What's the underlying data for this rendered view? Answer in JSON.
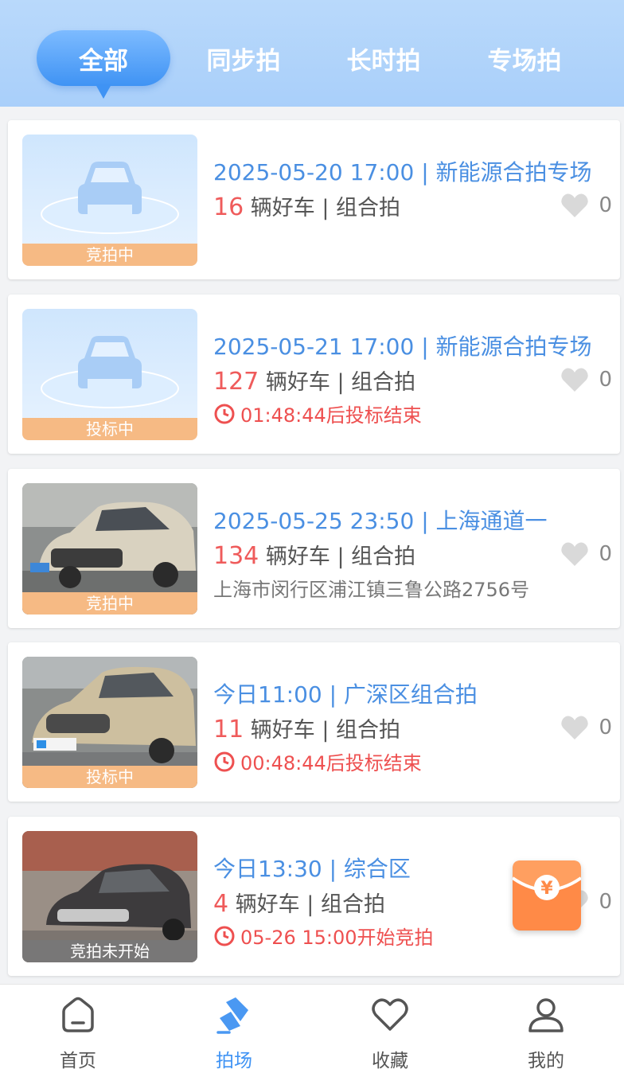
{
  "tabs": [
    {
      "label": "全部",
      "active": true
    },
    {
      "label": "同步拍",
      "active": false
    },
    {
      "label": "长时拍",
      "active": false
    },
    {
      "label": "专场拍",
      "active": false
    }
  ],
  "auctions": [
    {
      "title": "2025-05-20 17:00 | 新能源合拍专场",
      "count": "16",
      "desc": "辆好车 | 组合拍",
      "status": "竞拍中",
      "extra": "",
      "extra_type": "none",
      "favorites": "0",
      "image": "placeholder-car"
    },
    {
      "title": "2025-05-21 17:00 | 新能源合拍专场",
      "count": "127",
      "desc": "辆好车 | 组合拍",
      "status": "投标中",
      "extra": "01:48:44后投标结束",
      "extra_type": "countdown",
      "favorites": "0",
      "image": "placeholder-car"
    },
    {
      "title": "2025-05-25 23:50 | 上海通道一",
      "count": "134",
      "desc": "辆好车 | 组合拍",
      "status": "竞拍中",
      "extra": "上海市闵行区浦江镇三鲁公路2756号",
      "extra_type": "address",
      "favorites": "0",
      "image": "photo-suv-champagne"
    },
    {
      "title": "今日11:00 | 广深区组合拍",
      "count": "11",
      "desc": "辆好车 | 组合拍",
      "status": "投标中",
      "extra": "00:48:44后投标结束",
      "extra_type": "countdown",
      "favorites": "0",
      "image": "photo-suv-gold"
    },
    {
      "title": "今日13:30 | 综合区",
      "count": "4",
      "desc": "辆好车 | 组合拍",
      "status": "竞拍未开始",
      "extra": "05-26 15:00开始竞拍",
      "extra_type": "countdown",
      "favorites": "0",
      "image": "photo-sedan-dark"
    }
  ],
  "red_packet": {
    "symbol": "¥"
  },
  "bottom_nav": [
    {
      "label": "首页",
      "icon": "home-icon",
      "active": false
    },
    {
      "label": "拍场",
      "icon": "gavel-icon",
      "active": true
    },
    {
      "label": "收藏",
      "icon": "heart-icon",
      "active": false
    },
    {
      "label": "我的",
      "icon": "user-icon",
      "active": false
    }
  ],
  "colors": {
    "accent": "#3f93f4",
    "title_blue": "#4a8fe2",
    "count_red": "#ef5b5b",
    "status_orange": "#f6ba84",
    "red_packet": "#ff8a47"
  }
}
